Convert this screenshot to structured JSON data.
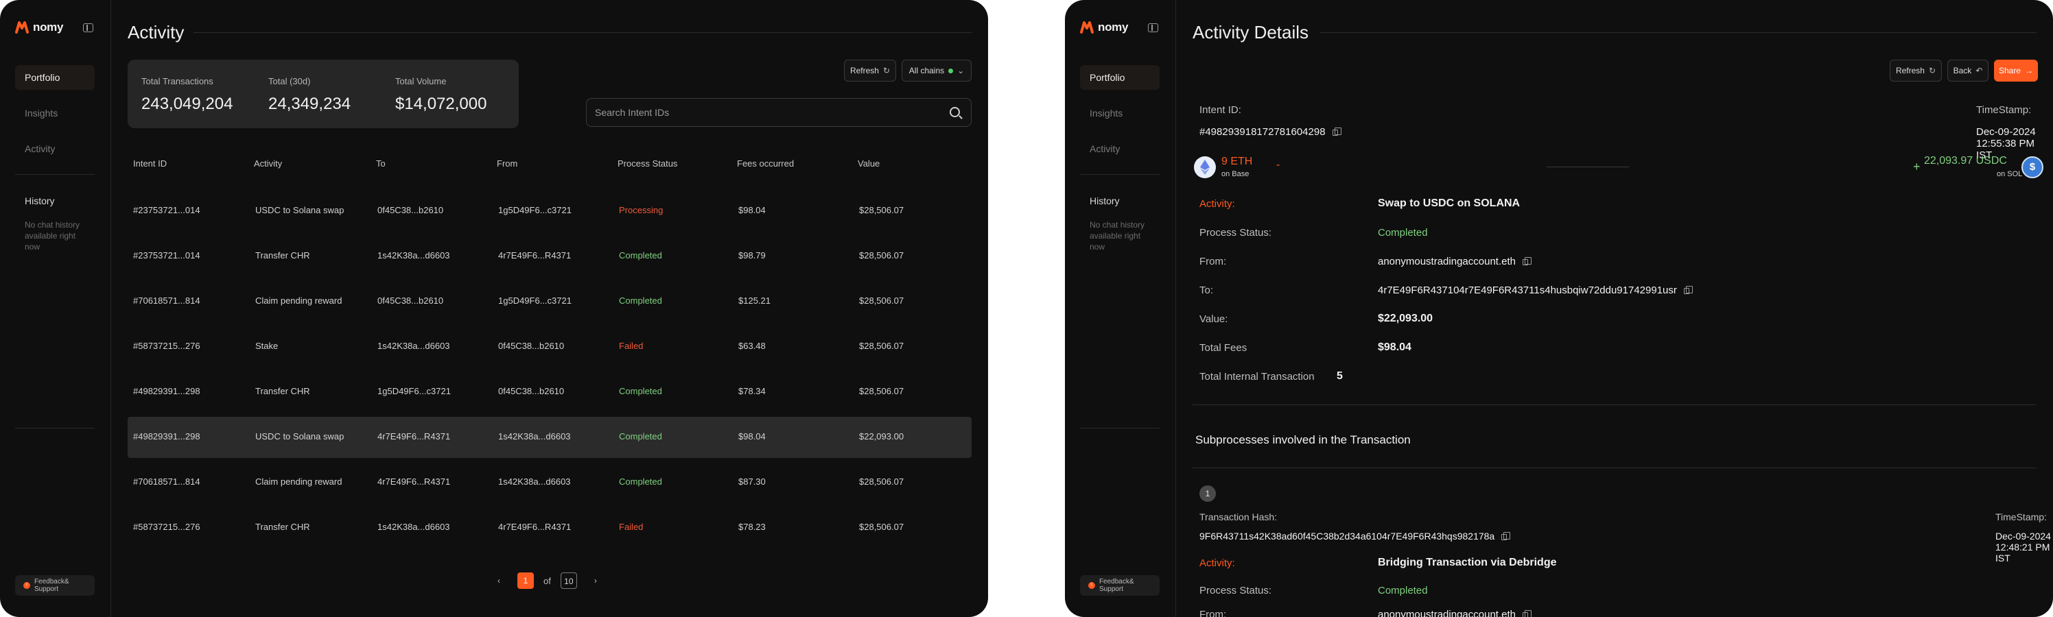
{
  "app": {
    "brand": "nomy"
  },
  "sidebar": {
    "items": [
      {
        "label": "Portfolio"
      },
      {
        "label": "Insights"
      },
      {
        "label": "Activity"
      }
    ],
    "history_title": "History",
    "history_empty": "No chat history available right now",
    "feedback_label": "Feedback& Support"
  },
  "activity": {
    "title": "Activity",
    "stats": [
      {
        "label": "Total Transactions",
        "value": "243,049,204"
      },
      {
        "label": "Total (30d)",
        "value": "24,349,234"
      },
      {
        "label": "Total Volume",
        "value": "$14,072,000"
      }
    ],
    "refresh_label": "Refresh",
    "chains_label": "All chains",
    "search_placeholder": "Search Intent IDs",
    "columns": [
      "Intent ID",
      "Activity",
      "To",
      "From",
      "Process Status",
      "Fees occurred",
      "Value"
    ],
    "rows": [
      {
        "id": "#23753721...014",
        "activity": "USDC to Solana swap",
        "to": "0f45C38...b2610",
        "from": "1g5D49F6...c3721",
        "status": "Processing",
        "fees": "$98.04",
        "value": "$28,506.07"
      },
      {
        "id": "#23753721...014",
        "activity": "Transfer CHR",
        "to": "1s42K38a...d6603",
        "from": "4r7E49F6...R4371",
        "status": "Completed",
        "fees": "$98.79",
        "value": "$28,506.07"
      },
      {
        "id": "#70618571...814",
        "activity": "Claim pending reward",
        "to": "0f45C38...b2610",
        "from": "1g5D49F6...c3721",
        "status": "Completed",
        "fees": "$125.21",
        "value": "$28,506.07"
      },
      {
        "id": "#58737215...276",
        "activity": "Stake",
        "to": "1s42K38a...d6603",
        "from": "0f45C38...b2610",
        "status": "Failed",
        "fees": "$63.48",
        "value": "$28,506.07"
      },
      {
        "id": "#49829391...298",
        "activity": "Transfer CHR",
        "to": "1g5D49F6...c3721",
        "from": "0f45C38...b2610",
        "status": "Completed",
        "fees": "$78.34",
        "value": "$28,506.07"
      },
      {
        "id": "#49829391...298",
        "activity": "USDC to Solana swap",
        "to": "4r7E49F6...R4371",
        "from": "1s42K38a...d6603",
        "status": "Completed",
        "fees": "$98.04",
        "value": "$22,093.00"
      },
      {
        "id": "#70618571...814",
        "activity": "Claim pending reward",
        "to": "4r7E49F6...R4371",
        "from": "1s42K38a...d6603",
        "status": "Completed",
        "fees": "$87.30",
        "value": "$28,506.07"
      },
      {
        "id": "#58737215...276",
        "activity": "Transfer CHR",
        "to": "1s42K38a...d6603",
        "from": "4r7E49F6...R4371",
        "status": "Failed",
        "fees": "$78.23",
        "value": "$28,506.07"
      }
    ],
    "pagination": {
      "current": "1",
      "of": "of",
      "total": "10",
      "prev": "‹",
      "next": "›"
    }
  },
  "details": {
    "title": "Activity Details",
    "refresh_label": "Refresh",
    "back_label": "Back",
    "share_label": "Share",
    "intent_label": "Intent ID:",
    "intent_value": "#498293918172781604298",
    "timestamp_label": "TimeStamp:",
    "timestamp_value": "Dec-09-2024 12:55:38 PM IST",
    "from_token": {
      "amount": "9 ETH",
      "sign": "-",
      "chain": "on Base"
    },
    "to_token": {
      "amount": "22,093.97 USDC",
      "sign": "+",
      "chain": "on SOL"
    },
    "fields": {
      "activity_label": "Activity:",
      "activity_value": "Swap to USDC on SOLANA",
      "status_label": "Process Status:",
      "status_value": "Completed",
      "from_label": "From:",
      "from_value": "anonymoustradingaccount.eth",
      "to_label": "To:",
      "to_value": "4r7E49F6R437104r7E49F6R43711s4husbqiw72ddu91742991usr",
      "value_label": "Value:",
      "value_value": "$22,093.00",
      "fees_label": "Total Fees",
      "fees_value": "$98.04",
      "internal_label": "Total Internal Transaction",
      "internal_value": "5"
    },
    "subprocess_title": "Subprocesses involved in the Transaction",
    "step": {
      "number": "1",
      "hash_label": "Transaction Hash:",
      "hash_value": "9F6R43711s42K38ad60f45C38b2d34a6104r7E49F6R43hqs982178a",
      "timestamp_label": "TimeStamp:",
      "timestamp_value": "Dec-09-2024 12:48:21 PM IST",
      "activity_label": "Activity:",
      "activity_value": "Bridging Transaction via Debridge",
      "status_label": "Process Status:",
      "status_value": "Completed",
      "from_label": "From:",
      "from_value": "anonymoustradingaccount.eth"
    }
  },
  "colors": {
    "accent": "#ff5a1f",
    "success": "#7fd07f",
    "danger": "#ef5a3a",
    "panel": "#0f0f0f"
  }
}
